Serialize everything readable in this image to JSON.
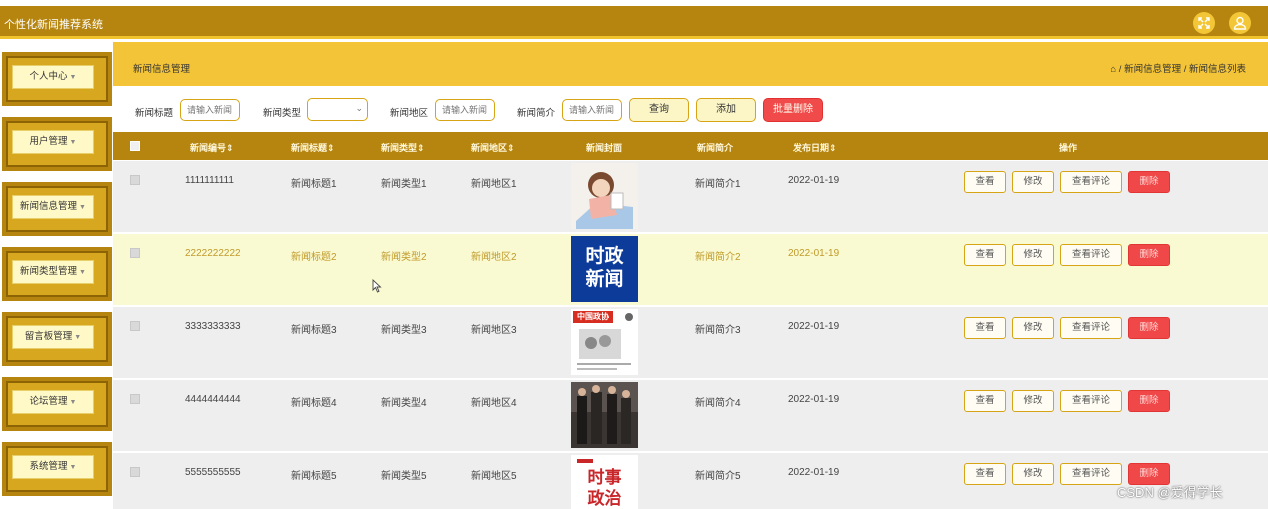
{
  "app": {
    "title": "个性化新闻推荐系统",
    "fullscreen_icon": "fullscreen-icon",
    "user_icon": "user-avatar-icon"
  },
  "sidebar": {
    "items": [
      {
        "label": "个人中心"
      },
      {
        "label": "用户管理"
      },
      {
        "label": "新闻信息管理"
      },
      {
        "label": "新闻类型管理"
      },
      {
        "label": "留言板管理"
      },
      {
        "label": "论坛管理"
      },
      {
        "label": "系统管理"
      }
    ]
  },
  "page": {
    "title": "新闻信息管理",
    "breadcrumb": "⌂ / 新闻信息管理 / 新闻信息列表"
  },
  "filters": {
    "title_label": "新闻标题",
    "title_placeholder": "请输入新闻",
    "type_label": "新闻类型",
    "type_value": "",
    "region_label": "新闻地区",
    "region_placeholder": "请输入新闻",
    "intro_label": "新闻简介",
    "intro_placeholder": "请输入新闻",
    "query_button": "查询",
    "add_button": "添加",
    "batch_delete_button": "批量删除"
  },
  "table": {
    "columns": [
      "新闻编号⇕",
      "新闻标题⇕",
      "新闻类型⇕",
      "新闻地区⇕",
      "新闻封面",
      "新闻简介",
      "发布日期⇕",
      "操作"
    ],
    "actions": {
      "view": "查看",
      "edit": "修改",
      "comments": "查看评论",
      "delete": "删除"
    },
    "rows": [
      {
        "id": "1111111111",
        "title": "新闻标题1",
        "type": "新闻类型1",
        "region": "新闻地区1",
        "intro": "新闻简介1",
        "date": "2022-01-19"
      },
      {
        "id": "2222222222",
        "title": "新闻标题2",
        "type": "新闻类型2",
        "region": "新闻地区2",
        "intro": "新闻简介2",
        "date": "2022-01-19",
        "cover_text": [
          "时政",
          "新闻"
        ]
      },
      {
        "id": "3333333333",
        "title": "新闻标题3",
        "type": "新闻类型3",
        "region": "新闻地区3",
        "intro": "新闻简介3",
        "date": "2022-01-19",
        "cover_text": [
          "中国政协"
        ]
      },
      {
        "id": "4444444444",
        "title": "新闻标题4",
        "type": "新闻类型4",
        "region": "新闻地区4",
        "intro": "新闻简介4",
        "date": "2022-01-19"
      },
      {
        "id": "5555555555",
        "title": "新闻标题5",
        "type": "新闻类型5",
        "region": "新闻地区5",
        "intro": "新闻简介5",
        "date": "2022-01-19",
        "cover_text": [
          "时事",
          "政治"
        ]
      }
    ]
  },
  "watermark": "CSDN @爱得学长",
  "colors": {
    "header_dark": "#b5850f",
    "header_bright": "#f3c437",
    "highlight_row": "#fafad2",
    "delete_red": "#f04848"
  }
}
